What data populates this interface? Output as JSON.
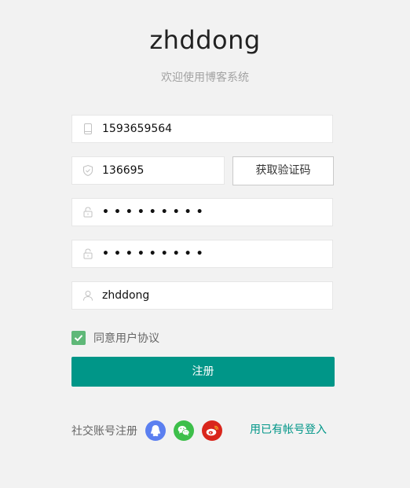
{
  "header": {
    "title": "zhddong",
    "subtitle": "欢迎使用博客系统"
  },
  "form": {
    "phone": {
      "value": "1593659564",
      "icon": "cellphone-icon"
    },
    "code": {
      "value": "136695",
      "icon": "shield-icon",
      "button_label": "获取验证码"
    },
    "password": {
      "value": "•••••••••",
      "icon": "lock-icon"
    },
    "confirm_password": {
      "value": "•••••••••",
      "icon": "lock-icon"
    },
    "nickname": {
      "value": "zhddong",
      "icon": "user-icon"
    },
    "agreement": {
      "label": "同意用户协议",
      "checked": true
    },
    "submit_label": "注册"
  },
  "footer": {
    "social_label": "社交账号注册",
    "social_icons": [
      "qq-icon",
      "wechat-icon",
      "weibo-icon"
    ],
    "login_link": "用已有帐号登入"
  },
  "colors": {
    "primary": "#009688",
    "checkbox": "#5fb878",
    "qq": "#5b7ff0",
    "wechat": "#3dbf4a",
    "weibo": "#d9261c",
    "background": "#f2f2f2"
  }
}
